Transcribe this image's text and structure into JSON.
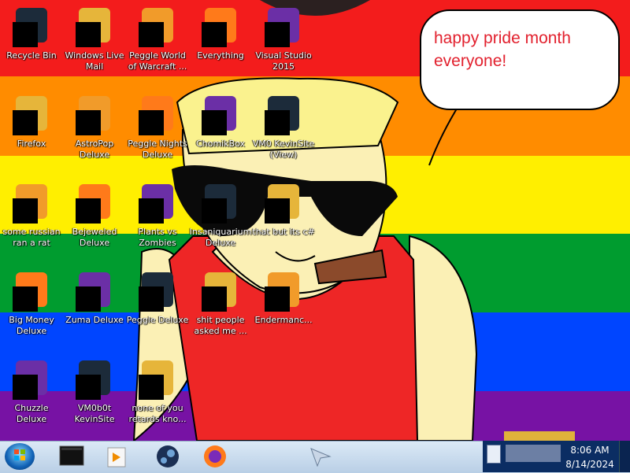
{
  "speech_bubble": {
    "text": "happy pride month everyone!"
  },
  "desktop_icons": [
    {
      "label": "Recycle Bin",
      "icon": "recycle-bin-icon"
    },
    {
      "label": "Windows Live Mail",
      "icon": "windows-live-mail-icon"
    },
    {
      "label": "Peggle World of Warcraft ...",
      "icon": "peggle-wow-icon"
    },
    {
      "label": "Everything",
      "icon": "everything-search-icon"
    },
    {
      "label": "Visual Studio 2015",
      "icon": "visual-studio-icon"
    },
    {
      "label": "Firefox",
      "icon": "firefox-icon"
    },
    {
      "label": "AstroPop Deluxe",
      "icon": "astropop-icon"
    },
    {
      "label": "Peggle Nights Deluxe",
      "icon": "peggle-nights-icon"
    },
    {
      "label": "ChomikBox",
      "icon": "chomikbox-icon"
    },
    {
      "label": "VM0 KevinSite (View)",
      "icon": "vm-kevinsite-view-icon"
    },
    {
      "label": "some russian ran a rat",
      "icon": "russian-rat-icon"
    },
    {
      "label": "Bejeweled Deluxe",
      "icon": "bejeweled-icon"
    },
    {
      "label": "Plants vs Zombies",
      "icon": "plants-vs-zombies-icon"
    },
    {
      "label": "Insaniquarium Deluxe",
      "icon": "insaniquarium-icon"
    },
    {
      "label": "that but its c#",
      "icon": "csharp-folder-icon"
    },
    {
      "label": "Big Money Deluxe",
      "icon": "big-money-icon"
    },
    {
      "label": "Zuma Deluxe",
      "icon": "zuma-icon"
    },
    {
      "label": "Peggle Deluxe",
      "icon": "peggle-deluxe-icon"
    },
    {
      "label": "shit people asked me ...",
      "icon": "document-icon"
    },
    {
      "label": "Endermanc...",
      "icon": "enderman-terminal-icon"
    },
    {
      "label": "Chuzzle Deluxe",
      "icon": "chuzzle-icon"
    },
    {
      "label": "VM0b0t KevinSite",
      "icon": "vm-kevinsite-bot-icon"
    },
    {
      "label": "none of you retards kno...",
      "icon": "peggle-ball-icon"
    }
  ],
  "taskbar": {
    "items": [
      {
        "name": "terminal",
        "icon": "terminal-icon"
      },
      {
        "name": "media player",
        "icon": "media-player-icon"
      },
      {
        "name": "steam",
        "icon": "steam-icon"
      },
      {
        "name": "firefox",
        "icon": "firefox-icon"
      }
    ],
    "clock": {
      "time": "8:06 AM",
      "date": "8/14/2024"
    }
  },
  "colors": {
    "stripe_red": "#f31c1c",
    "stripe_orange": "#ff8c00",
    "stripe_yellow": "#ffef00",
    "stripe_green": "#009c2f",
    "stripe_blue": "#0045ff",
    "stripe_purple": "#7712a4",
    "bubble_text": "#e2212e",
    "taskbar": "#c6d8ec"
  }
}
